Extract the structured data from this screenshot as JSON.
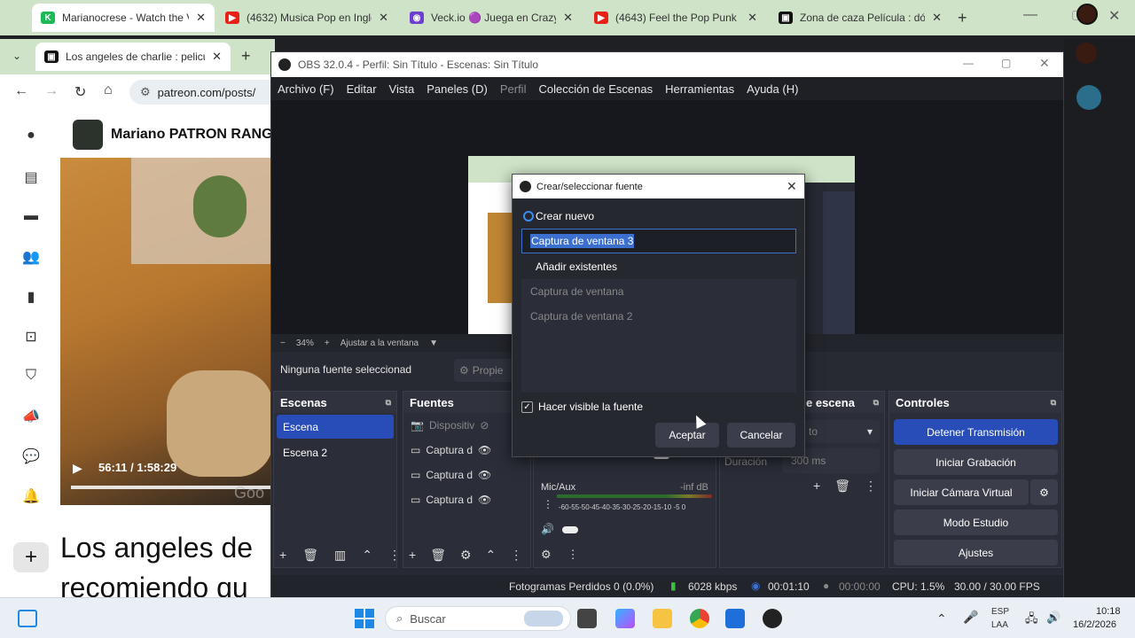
{
  "browser": {
    "tabs": [
      {
        "title": "Marianocrese - Watch the V",
        "favicon": "K",
        "color": "#1db954"
      },
      {
        "title": "(4632) Musica Pop en Ingle",
        "favicon": "▶",
        "color": "#e62117"
      },
      {
        "title": "Veck.io 🟣 Juega en CrazyG",
        "favicon": "◉",
        "color": "#6c3fd1"
      },
      {
        "title": "(4643) Feel the Pop Punk En",
        "favicon": "▶",
        "color": "#e62117"
      },
      {
        "title": "Zona de caza Película : dón",
        "favicon": "▣",
        "color": "#111"
      }
    ],
    "window_tab": "Los angeles de charlie : pelicula",
    "address": "patreon.com/posts/",
    "creator": "Mariano PATRON RANG",
    "video_time": "56:11 / 1:58:29",
    "watermark": "Goo",
    "post_title_1": "Los angeles de",
    "post_title_2": "recomiendo qu"
  },
  "obs": {
    "title": "OBS 32.0.4 - Perfil: Sin Título - Escenas: Sin Título",
    "menu": [
      "Archivo (F)",
      "Editar",
      "Vista",
      "Paneles (D)",
      "Perfil",
      "Colección de Escenas",
      "Herramientas",
      "Ayuda (H)"
    ],
    "zoom": "34%",
    "zoom_fit": "Ajustar a la ventana",
    "no_source": "Ninguna fuente seleccionad",
    "properties": "Propie",
    "scenes_title": "Escenas",
    "scenes": [
      "Escena",
      "Escena 2"
    ],
    "sources_title": "Fuentes",
    "sources": [
      "Dispositiv",
      "Captura d",
      "Captura d",
      "Captura d"
    ],
    "transitions_title": "e escena",
    "transition_value": "to",
    "duration_label": "Duración",
    "duration_value": "300 ms",
    "mixer_label": "Mic/Aux",
    "mixer_db": "-inf dB",
    "mixer_ticks": "-60-55-50-45-40-35-30-25-20-15-10 -5 0",
    "controls_title": "Controles",
    "controls": [
      "Detener Transmisión",
      "Iniciar Grabación",
      "Iniciar Cámara Virtual",
      "Modo Estudio",
      "Ajustes"
    ],
    "status": {
      "frames": "Fotogramas Perdidos 0 (0.0%)",
      "kbps": "6028 kbps",
      "stream_time": "00:01:10",
      "rec_time": "00:00:00",
      "cpu": "CPU: 1.5%",
      "fps": "30.00 / 30.00 FPS"
    }
  },
  "dialog": {
    "title": "Crear/seleccionar fuente",
    "create_new": "Crear nuevo",
    "name_value": "Captura de ventana 3",
    "add_existing": "Añadir existentes",
    "existing": [
      "Captura de ventana",
      "Captura de ventana 2"
    ],
    "make_visible": "Hacer visible la fuente",
    "ok": "Aceptar",
    "cancel": "Cancelar"
  },
  "taskbar": {
    "search": "Buscar",
    "lang_1": "ESP",
    "lang_2": "LAA",
    "time": "10:18",
    "date": "16/2/2026"
  }
}
